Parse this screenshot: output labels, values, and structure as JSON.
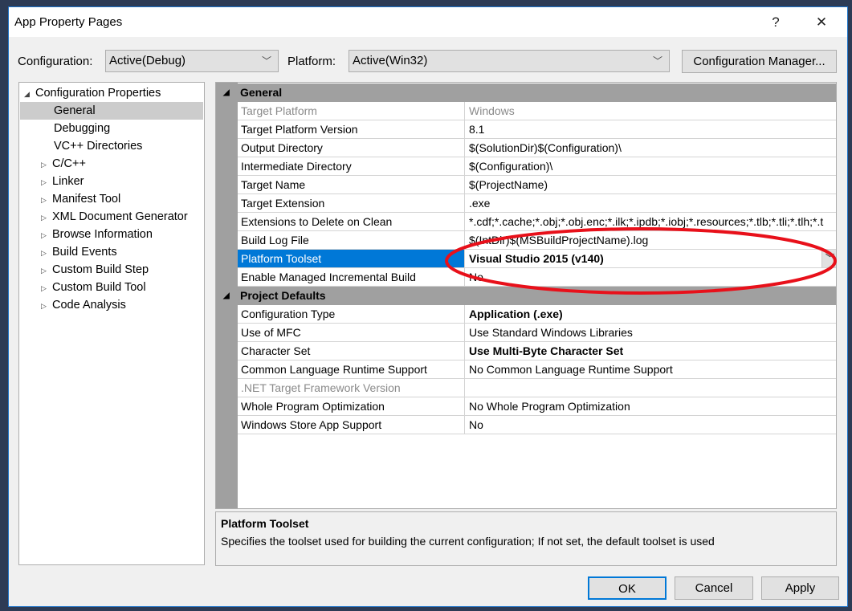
{
  "window": {
    "title": "App Property Pages",
    "help": "?",
    "close": "✕"
  },
  "toolbar": {
    "configuration_label": "Configuration:",
    "configuration_value": "Active(Debug)",
    "platform_label": "Platform:",
    "platform_value": "Active(Win32)",
    "config_manager": "Configuration Manager..."
  },
  "tree": {
    "root": "Configuration Properties",
    "items": [
      {
        "label": "General",
        "expandable": false,
        "selected": true
      },
      {
        "label": "Debugging",
        "expandable": false
      },
      {
        "label": "VC++ Directories",
        "expandable": false
      },
      {
        "label": "C/C++",
        "expandable": true
      },
      {
        "label": "Linker",
        "expandable": true
      },
      {
        "label": "Manifest Tool",
        "expandable": true
      },
      {
        "label": "XML Document Generator",
        "expandable": true
      },
      {
        "label": "Browse Information",
        "expandable": true
      },
      {
        "label": "Build Events",
        "expandable": true
      },
      {
        "label": "Custom Build Step",
        "expandable": true
      },
      {
        "label": "Custom Build Tool",
        "expandable": true
      },
      {
        "label": "Code Analysis",
        "expandable": true
      }
    ]
  },
  "grid": {
    "categories": [
      {
        "name": "General",
        "rows": [
          {
            "name": "Target Platform",
            "value": "Windows",
            "gray": true
          },
          {
            "name": "Target Platform Version",
            "value": "8.1"
          },
          {
            "name": "Output Directory",
            "value": "$(SolutionDir)$(Configuration)\\"
          },
          {
            "name": "Intermediate Directory",
            "value": "$(Configuration)\\"
          },
          {
            "name": "Target Name",
            "value": "$(ProjectName)"
          },
          {
            "name": "Target Extension",
            "value": ".exe"
          },
          {
            "name": "Extensions to Delete on Clean",
            "value": "*.cdf;*.cache;*.obj;*.obj.enc;*.ilk;*.ipdb;*.iobj;*.resources;*.tlb;*.tli;*.tlh;*.t"
          },
          {
            "name": "Build Log File",
            "value": "$(IntDir)$(MSBuildProjectName).log"
          },
          {
            "name": "Platform Toolset",
            "value": "Visual Studio 2015 (v140)",
            "bold": true,
            "selected": true
          },
          {
            "name": "Enable Managed Incremental Build",
            "value": "No"
          }
        ]
      },
      {
        "name": "Project Defaults",
        "rows": [
          {
            "name": "Configuration Type",
            "value": "Application (.exe)",
            "bold": true
          },
          {
            "name": "Use of MFC",
            "value": "Use Standard Windows Libraries"
          },
          {
            "name": "Character Set",
            "value": "Use Multi-Byte Character Set",
            "bold": true
          },
          {
            "name": "Common Language Runtime Support",
            "value": "No Common Language Runtime Support"
          },
          {
            "name": ".NET Target Framework Version",
            "value": "",
            "gray": true
          },
          {
            "name": "Whole Program Optimization",
            "value": "No Whole Program Optimization"
          },
          {
            "name": "Windows Store App Support",
            "value": "No"
          }
        ]
      }
    ]
  },
  "description": {
    "title": "Platform Toolset",
    "text": "Specifies the toolset used for building the current configuration; If not set, the default toolset is used"
  },
  "buttons": {
    "ok": "OK",
    "cancel": "Cancel",
    "apply": "Apply"
  },
  "colors": {
    "selection": "#0078d7",
    "annotation": "#e8101a"
  }
}
